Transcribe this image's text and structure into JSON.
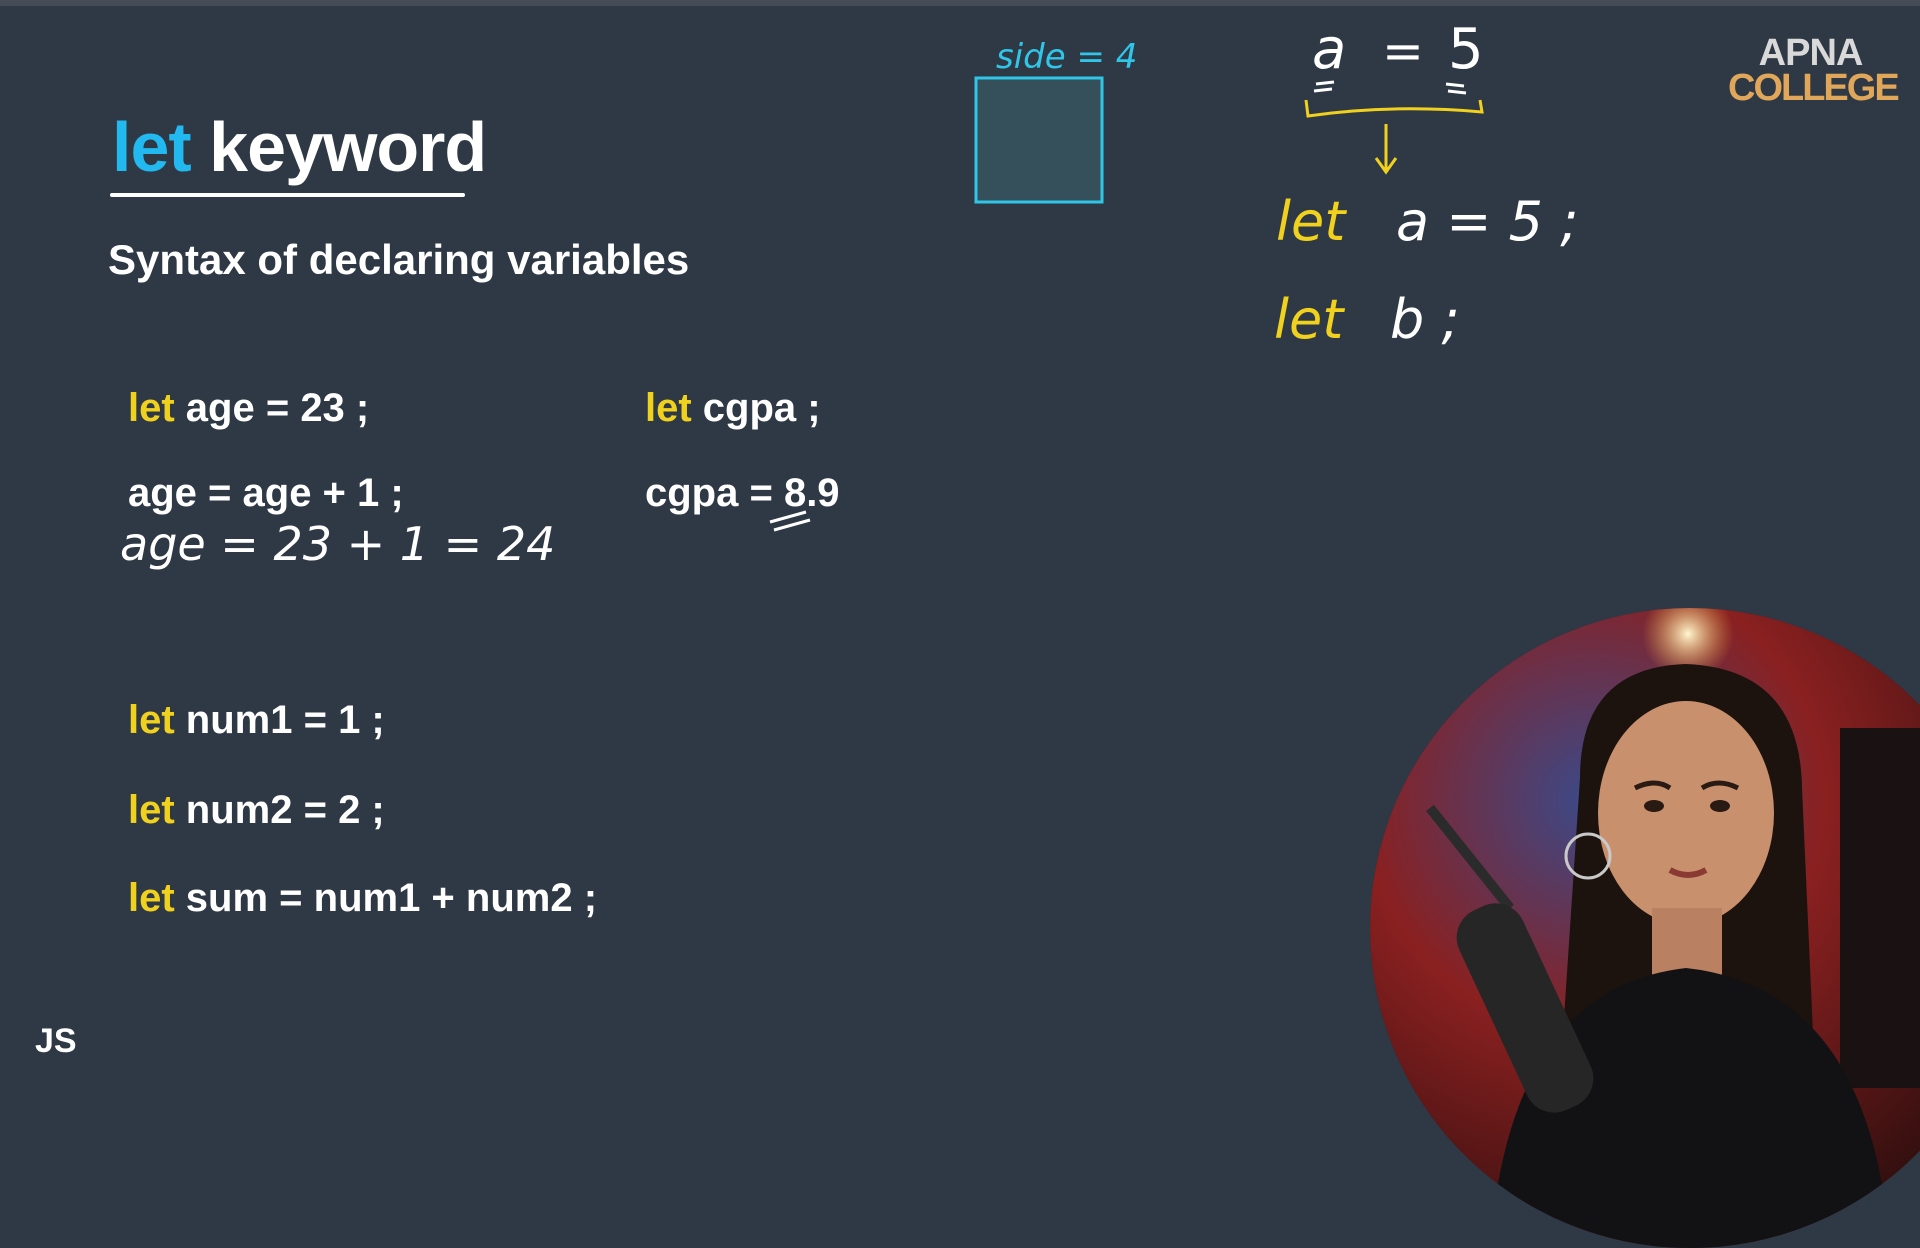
{
  "slide": {
    "title_keyword": "let",
    "title_rest": "keyword",
    "subtitle": "Syntax of declaring variables",
    "corner_label": "JS",
    "logo_line1": "APNA",
    "logo_line2": "COLLEGE"
  },
  "code_lines": [
    {
      "kw": "let",
      "rest": " age = 23 ;"
    },
    {
      "kw": "",
      "rest": "age = age + 1 ;"
    },
    {
      "kw": "let",
      "rest": " num1 = 1 ;"
    },
    {
      "kw": "let",
      "rest": " num2 = 2 ;"
    },
    {
      "kw": "let",
      "rest": " sum = num1 + num2 ;"
    },
    {
      "kw": "let",
      "rest": " cgpa ;"
    },
    {
      "kw": "",
      "rest": "cgpa = 8.9"
    }
  ],
  "annotations": {
    "age_calc": "age = 23 + 1 = 24",
    "box_label": "side = 4",
    "eq_a": "a",
    "eq_sign": "=",
    "eq_five": "5",
    "let_a_kw": "let",
    "let_a_rest": "a = 5 ;",
    "let_b_kw": "let",
    "let_b_rest": "b ;"
  },
  "colors": {
    "background": "#2f3845",
    "keyword_blue": "#22b8f0",
    "keyword_yellow": "#f0d11e",
    "box_cyan": "#2fc6e8",
    "logo_orange": "#e0a75a"
  }
}
